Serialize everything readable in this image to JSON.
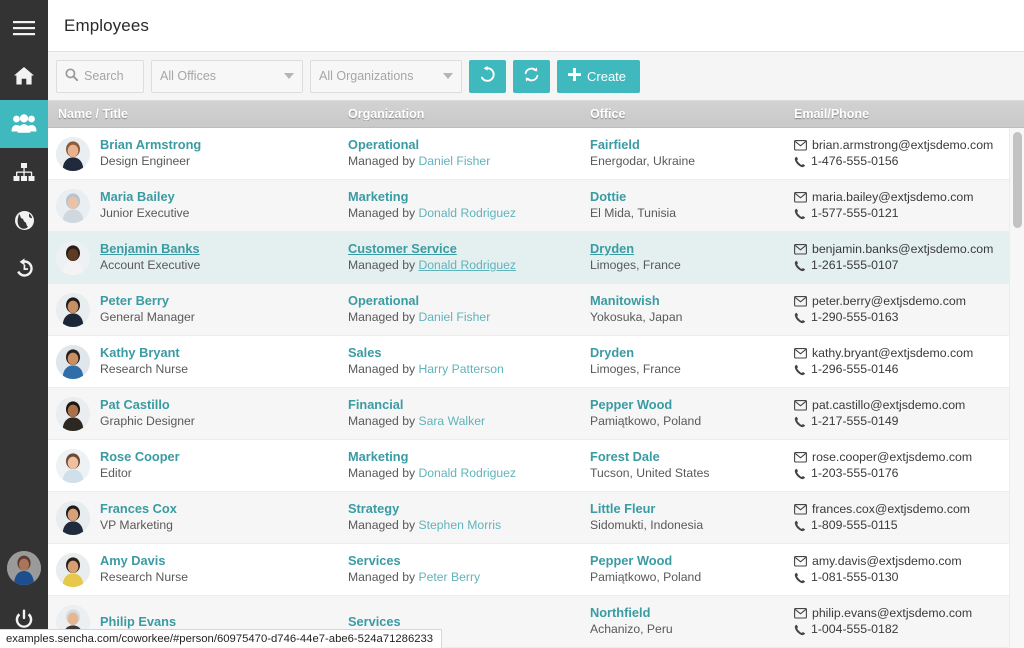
{
  "app": {
    "accent": "#3fb8be",
    "sidebar_bg": "#333333",
    "header_bg": "#c9c9c9",
    "link_color": "#3a9ba3"
  },
  "header": {
    "title": "Employees"
  },
  "sidebar": {
    "items": [
      {
        "name": "menu-toggle",
        "icon": "hamburger-icon",
        "active": false
      },
      {
        "name": "home",
        "icon": "home-icon",
        "active": false
      },
      {
        "name": "employees",
        "icon": "people-icon",
        "active": true
      },
      {
        "name": "org-chart",
        "icon": "sitemap-icon",
        "active": false
      },
      {
        "name": "globe",
        "icon": "globe-icon",
        "active": false
      },
      {
        "name": "history",
        "icon": "history-icon",
        "active": false
      }
    ],
    "footer": [
      {
        "name": "user-avatar",
        "icon": "avatar-icon"
      },
      {
        "name": "logout",
        "icon": "power-icon"
      }
    ]
  },
  "toolbar": {
    "search_placeholder": "Search",
    "search_value": "",
    "offices_label": "All Offices",
    "organizations_label": "All Organizations",
    "reset_icon": "undo-icon",
    "refresh_icon": "refresh-icon",
    "create_label": "Create",
    "create_icon": "plus-icon"
  },
  "grid": {
    "columns": [
      {
        "key": "name",
        "label": "Name / Title"
      },
      {
        "key": "org",
        "label": "Organization"
      },
      {
        "key": "office",
        "label": "Office"
      },
      {
        "key": "contact",
        "label": "Email/Phone"
      }
    ],
    "managed_by_prefix": "Managed by ",
    "rows": [
      {
        "name": "Brian Armstrong",
        "title": "Design Engineer",
        "org": "Operational",
        "manager": "Daniel Fisher",
        "office": "Fairfield",
        "location": "Energodar, Ukraine",
        "email": "brian.armstrong@extjsdemo.com",
        "phone": "1-476-555-0156"
      },
      {
        "name": "Maria Bailey",
        "title": "Junior Executive",
        "org": "Marketing",
        "manager": "Donald Rodriguez",
        "office": "Dottie",
        "location": "El Mida, Tunisia",
        "email": "maria.bailey@extjsdemo.com",
        "phone": "1-577-555-0121"
      },
      {
        "name": "Benjamin Banks",
        "title": "Account Executive",
        "org": "Customer Service",
        "manager": "Donald Rodriguez",
        "office": "Dryden",
        "location": "Limoges, France",
        "email": "benjamin.banks@extjsdemo.com",
        "phone": "1-261-555-0107"
      },
      {
        "name": "Peter Berry",
        "title": "General Manager",
        "org": "Operational",
        "manager": "Daniel Fisher",
        "office": "Manitowish",
        "location": "Yokosuka, Japan",
        "email": "peter.berry@extjsdemo.com",
        "phone": "1-290-555-0163"
      },
      {
        "name": "Kathy Bryant",
        "title": "Research Nurse",
        "org": "Sales",
        "manager": "Harry Patterson",
        "office": "Dryden",
        "location": "Limoges, France",
        "email": "kathy.bryant@extjsdemo.com",
        "phone": "1-296-555-0146"
      },
      {
        "name": "Pat Castillo",
        "title": "Graphic Designer",
        "org": "Financial",
        "manager": "Sara Walker",
        "office": "Pepper Wood",
        "location": "Pamiątkowo, Poland",
        "email": "pat.castillo@extjsdemo.com",
        "phone": "1-217-555-0149"
      },
      {
        "name": "Rose Cooper",
        "title": "Editor",
        "org": "Marketing",
        "manager": "Donald Rodriguez",
        "office": "Forest Dale",
        "location": "Tucson, United States",
        "email": "rose.cooper@extjsdemo.com",
        "phone": "1-203-555-0176"
      },
      {
        "name": "Frances Cox",
        "title": "VP Marketing",
        "org": "Strategy",
        "manager": "Stephen Morris",
        "office": "Little Fleur",
        "location": "Sidomukti, Indonesia",
        "email": "frances.cox@extjsdemo.com",
        "phone": "1-809-555-0115"
      },
      {
        "name": "Amy Davis",
        "title": "Research Nurse",
        "org": "Services",
        "manager": "Peter Berry",
        "office": "Pepper Wood",
        "location": "Pamiątkowo, Poland",
        "email": "amy.davis@extjsdemo.com",
        "phone": "1-081-555-0130"
      },
      {
        "name": "Philip Evans",
        "title": "",
        "org": "Services",
        "manager": "",
        "office": "Northfield",
        "location": "Achanizo, Peru",
        "email": "philip.evans@extjsdemo.com",
        "phone": "1-004-555-0182"
      }
    ]
  },
  "statusbar": {
    "url": "examples.sencha.com/coworkee/#person/60975470-d746-44e7-abe6-524a71286233"
  }
}
